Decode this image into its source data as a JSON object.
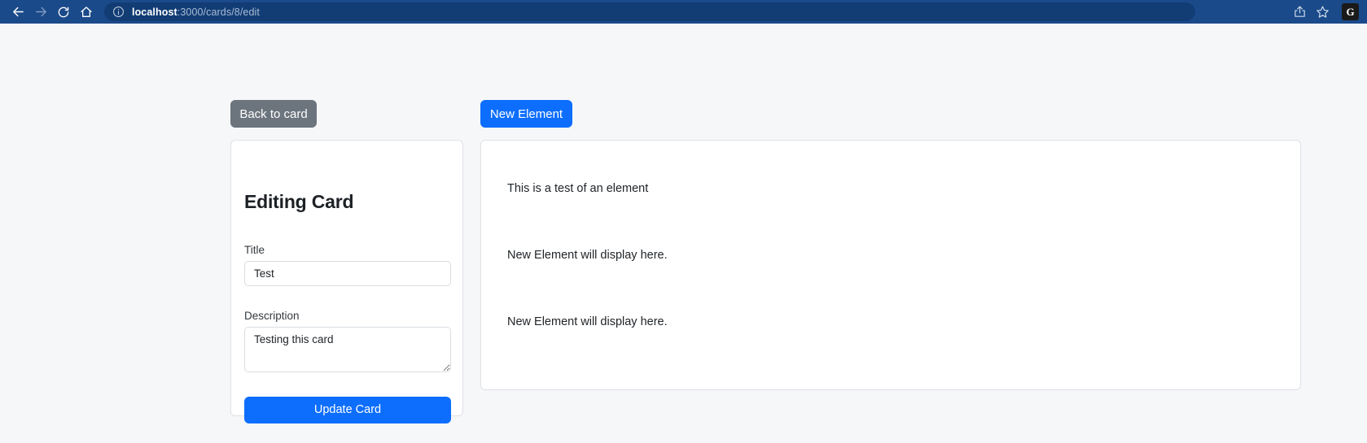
{
  "browser": {
    "back_icon": "arrow-left-icon",
    "forward_icon": "arrow-right-icon",
    "reload_icon": "reload-icon",
    "home_icon": "home-icon",
    "info_icon": "info-circle-icon",
    "url_host": "localhost",
    "url_path": ":3000/cards/8/edit",
    "share_icon": "share-icon",
    "bookmark_icon": "star-icon",
    "profile_initial": "G"
  },
  "toolbar": {
    "back_to_card_label": "Back to card",
    "new_element_label": "New Element"
  },
  "card_form": {
    "heading": "Editing Card",
    "title_label": "Title",
    "title_value": "Test",
    "title_placeholder": "Title",
    "description_label": "Description",
    "description_value": "Testing this card",
    "description_placeholder": "Description",
    "submit_label": "Update Card"
  },
  "elements_panel": {
    "items": [
      {
        "text": "This is a test of an element"
      },
      {
        "text": "New Element will display here."
      },
      {
        "text": "New Element will display here."
      }
    ]
  },
  "colors": {
    "primary": "#0d6efd",
    "secondary": "#6c757d",
    "chrome": "#1b4a8a",
    "page_bg": "#f6f7f9",
    "card_bg": "#ffffff",
    "border": "#dfe1e5"
  }
}
